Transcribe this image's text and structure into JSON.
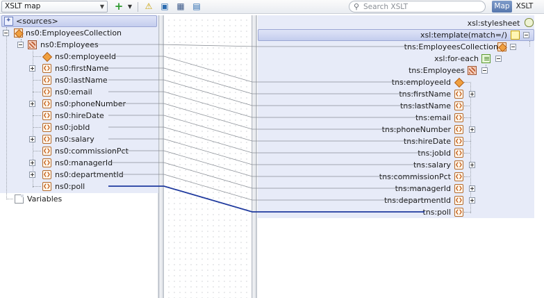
{
  "toolbar": {
    "mode": "XSLT map",
    "search_placeholder": "Search XSLT",
    "tab_map": "Map",
    "tab_xslt": "XSLT",
    "icons": [
      "add-icon",
      "dropdown-arrow-icon",
      "warning-icon",
      "test-run-icon",
      "save-map-icon",
      "xslt-file-icon"
    ]
  },
  "source": {
    "header": "<sources>",
    "collection": "ns0:EmployeesCollection",
    "record": "ns0:Employees",
    "fields": [
      "ns0:employeeId",
      "ns0:firstName",
      "ns0:lastName",
      "ns0:email",
      "ns0:phoneNumber",
      "ns0:hireDate",
      "ns0:jobId",
      "ns0:salary",
      "ns0:commissionPct",
      "ns0:managerId",
      "ns0:departmentId",
      "ns0:poll"
    ],
    "variables": "Variables"
  },
  "target": {
    "stylesheet": "xsl:stylesheet",
    "template": "xsl:template(match=/)",
    "collection": "tns:EmployeesCollection",
    "for_each": "xsl:for-each",
    "record": "tns:Employees",
    "fields": [
      "tns:employeeId",
      "tns:firstName",
      "tns:lastName",
      "tns:email",
      "tns:phoneNumber",
      "tns:hireDate",
      "tns:jobId",
      "tns:salary",
      "tns:commissionPct",
      "tns:managerId",
      "tns:departmentId",
      "tns:poll"
    ]
  },
  "colors": {
    "link_default": "#8a8f96",
    "link_selected": "#1f3a9e",
    "panel_shade": "#e7ebf8"
  }
}
